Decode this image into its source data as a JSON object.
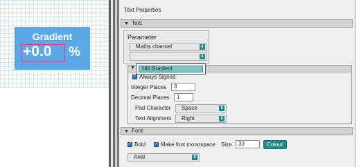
{
  "preview": {
    "title": "Gradient",
    "value": "+0.0",
    "unit": "%"
  },
  "panel": {
    "title": "Text Properties",
    "text_section": "Text",
    "parameter_label": "Parameter",
    "parameter_select": "Maths channel",
    "parameter_sub_select": "",
    "dropdown_item": "Hill Gradient",
    "always_signed_label": "Always Signed",
    "integer_places_label": "Integer Places",
    "integer_places_value": "3",
    "decimal_places_label": "Decimal Places",
    "decimal_places_value": "1",
    "pad_character_label": "Pad Character",
    "pad_character_value": "Space",
    "text_alignment_label": "Text Alignment",
    "text_alignment_value": "Right",
    "font_section": "Font",
    "bold_label": "Bold",
    "monospace_label": "Make font monospace",
    "size_label": "Size",
    "size_value": "33",
    "colour_button": "Colour",
    "font_select": "Arial"
  },
  "colors": {
    "widget_bg": "#5aa9e6",
    "accent": "#1f8a8a",
    "highlight": "#7ec4c4"
  }
}
